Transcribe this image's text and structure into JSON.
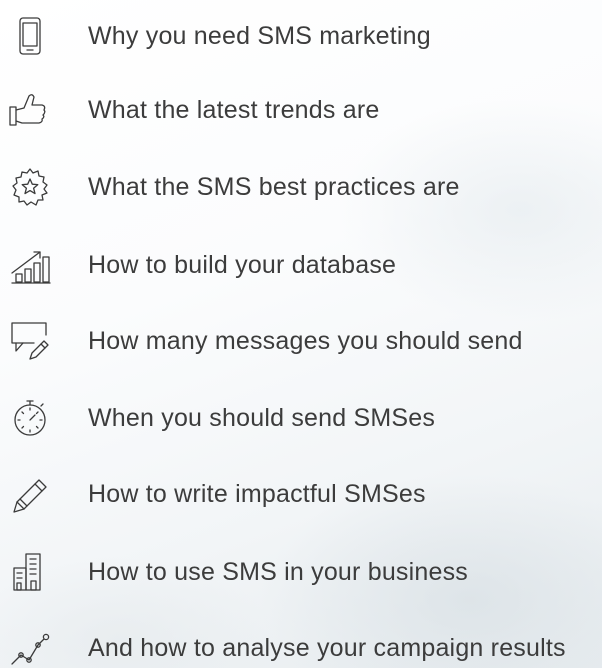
{
  "items": [
    {
      "label": "Why you need SMS marketing",
      "icon": "smartphone-icon"
    },
    {
      "label": "What the latest trends are",
      "icon": "thumbs-up-icon"
    },
    {
      "label": "What the SMS best practices are",
      "icon": "star-badge-icon"
    },
    {
      "label": "How to build your database",
      "icon": "growth-chart-icon"
    },
    {
      "label": "How many messages you should send",
      "icon": "message-edit-icon"
    },
    {
      "label": "When you should send SMSes",
      "icon": "stopwatch-icon"
    },
    {
      "label": "How to write impactful SMSes",
      "icon": "pencil-icon"
    },
    {
      "label": "How to use SMS in your business",
      "icon": "buildings-icon"
    },
    {
      "label": "And how to analyse your campaign results",
      "icon": "analytics-line-icon"
    }
  ]
}
